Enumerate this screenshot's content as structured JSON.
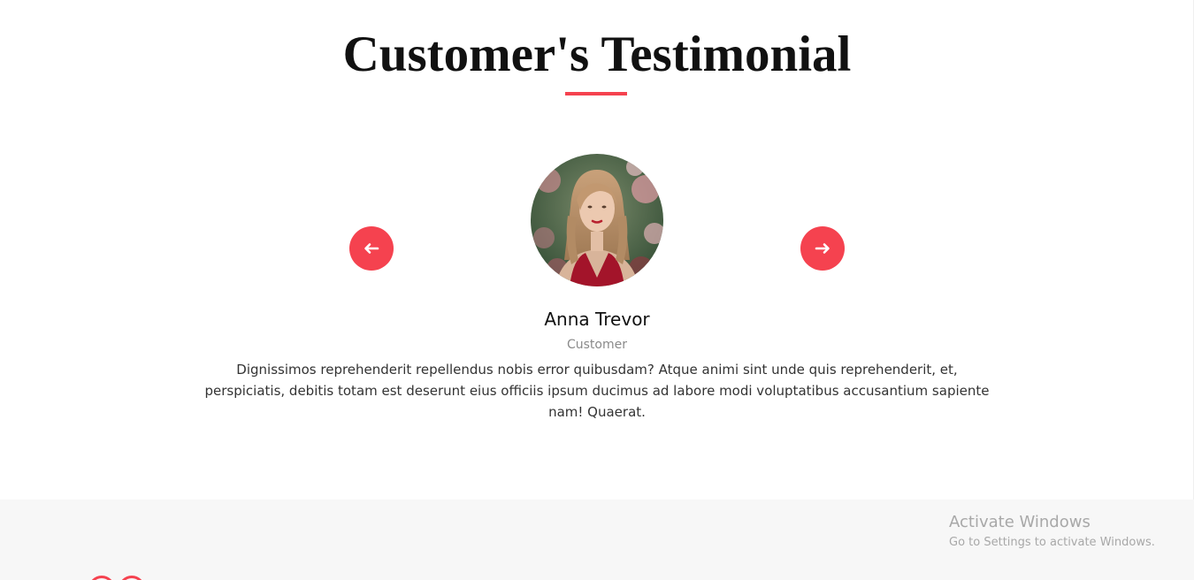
{
  "section": {
    "title": "Customer's Testimonial"
  },
  "colors": {
    "accent": "#f5424f",
    "footer_bg": "#f7f7f7",
    "text_primary": "#111111",
    "text_muted": "#8a8a8a"
  },
  "carousel": {
    "prev_icon": "arrow-left-icon",
    "next_icon": "arrow-right-icon"
  },
  "testimonial": {
    "name": "Anna Trevor",
    "role": "Customer",
    "quote": "Dignissimos reprehenderit repellendus nobis error quibusdam? Atque animi sint unde quis reprehenderit, et, perspiciatis, debitis totam est deserunt eius officiis ipsum ducimus ad labore modi voluptatibus accusantium sapiente nam! Quaerat."
  },
  "watermark": {
    "title": "Activate Windows",
    "subtitle": "Go to Settings to activate Windows."
  }
}
